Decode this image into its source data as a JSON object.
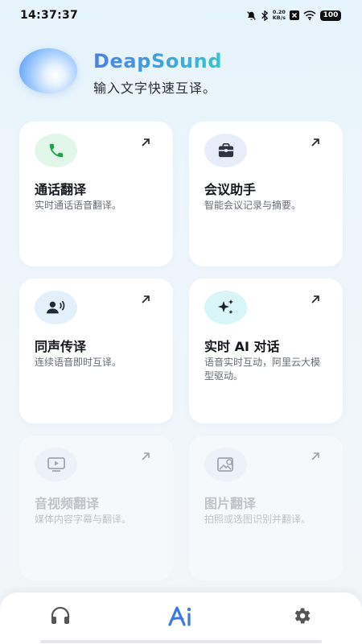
{
  "status_bar": {
    "time": "14:37:37",
    "net_speed_value": "0.20",
    "net_speed_unit": "KB/s",
    "battery": "100",
    "icons": [
      "mute-icon",
      "bluetooth-icon",
      "net-speed",
      "sim-off-icon",
      "wifi-icon",
      "battery-icon"
    ]
  },
  "header": {
    "app_name": "DeapSound",
    "tagline": "输入文字快速互译。"
  },
  "cards": [
    {
      "title": "通话翻译",
      "desc": "实时通话语音翻译。",
      "icon": "phone-icon",
      "icon_bg": "#e2f7ea",
      "enabled": true
    },
    {
      "title": "会议助手",
      "desc": "智能会议记录与摘要。",
      "icon": "briefcase-icon",
      "icon_bg": "#e8eef9",
      "enabled": true
    },
    {
      "title": "同声传译",
      "desc": "连续语音即时互译。",
      "icon": "speaker-person-icon",
      "icon_bg": "#e1f0fb",
      "enabled": true
    },
    {
      "title": "实时 AI 对话",
      "desc": "语音实时互动，阿里云大模型驱动。",
      "icon": "sparkle-icon",
      "icon_bg": "#d8f5f7",
      "enabled": true
    },
    {
      "title": "音视频翻译",
      "desc": "媒体内容字幕与翻译。",
      "icon": "video-icon",
      "icon_bg": "#e9eef6",
      "enabled": false
    },
    {
      "title": "图片翻译",
      "desc": "拍照或选图识别并翻译。",
      "icon": "image-search-icon",
      "icon_bg": "#e9eef6",
      "enabled": false
    }
  ],
  "bottom_nav": {
    "items": [
      {
        "name": "headphones-icon",
        "active": false
      },
      {
        "name": "ai-icon",
        "active": true
      },
      {
        "name": "gear-icon",
        "active": false
      }
    ],
    "active_color": "#3a78e8",
    "inactive_color": "#555555"
  },
  "colors": {
    "title_gradient_start": "#4a7fe6",
    "title_gradient_end": "#36c3d6",
    "phone_icon": "#1fa34c"
  }
}
